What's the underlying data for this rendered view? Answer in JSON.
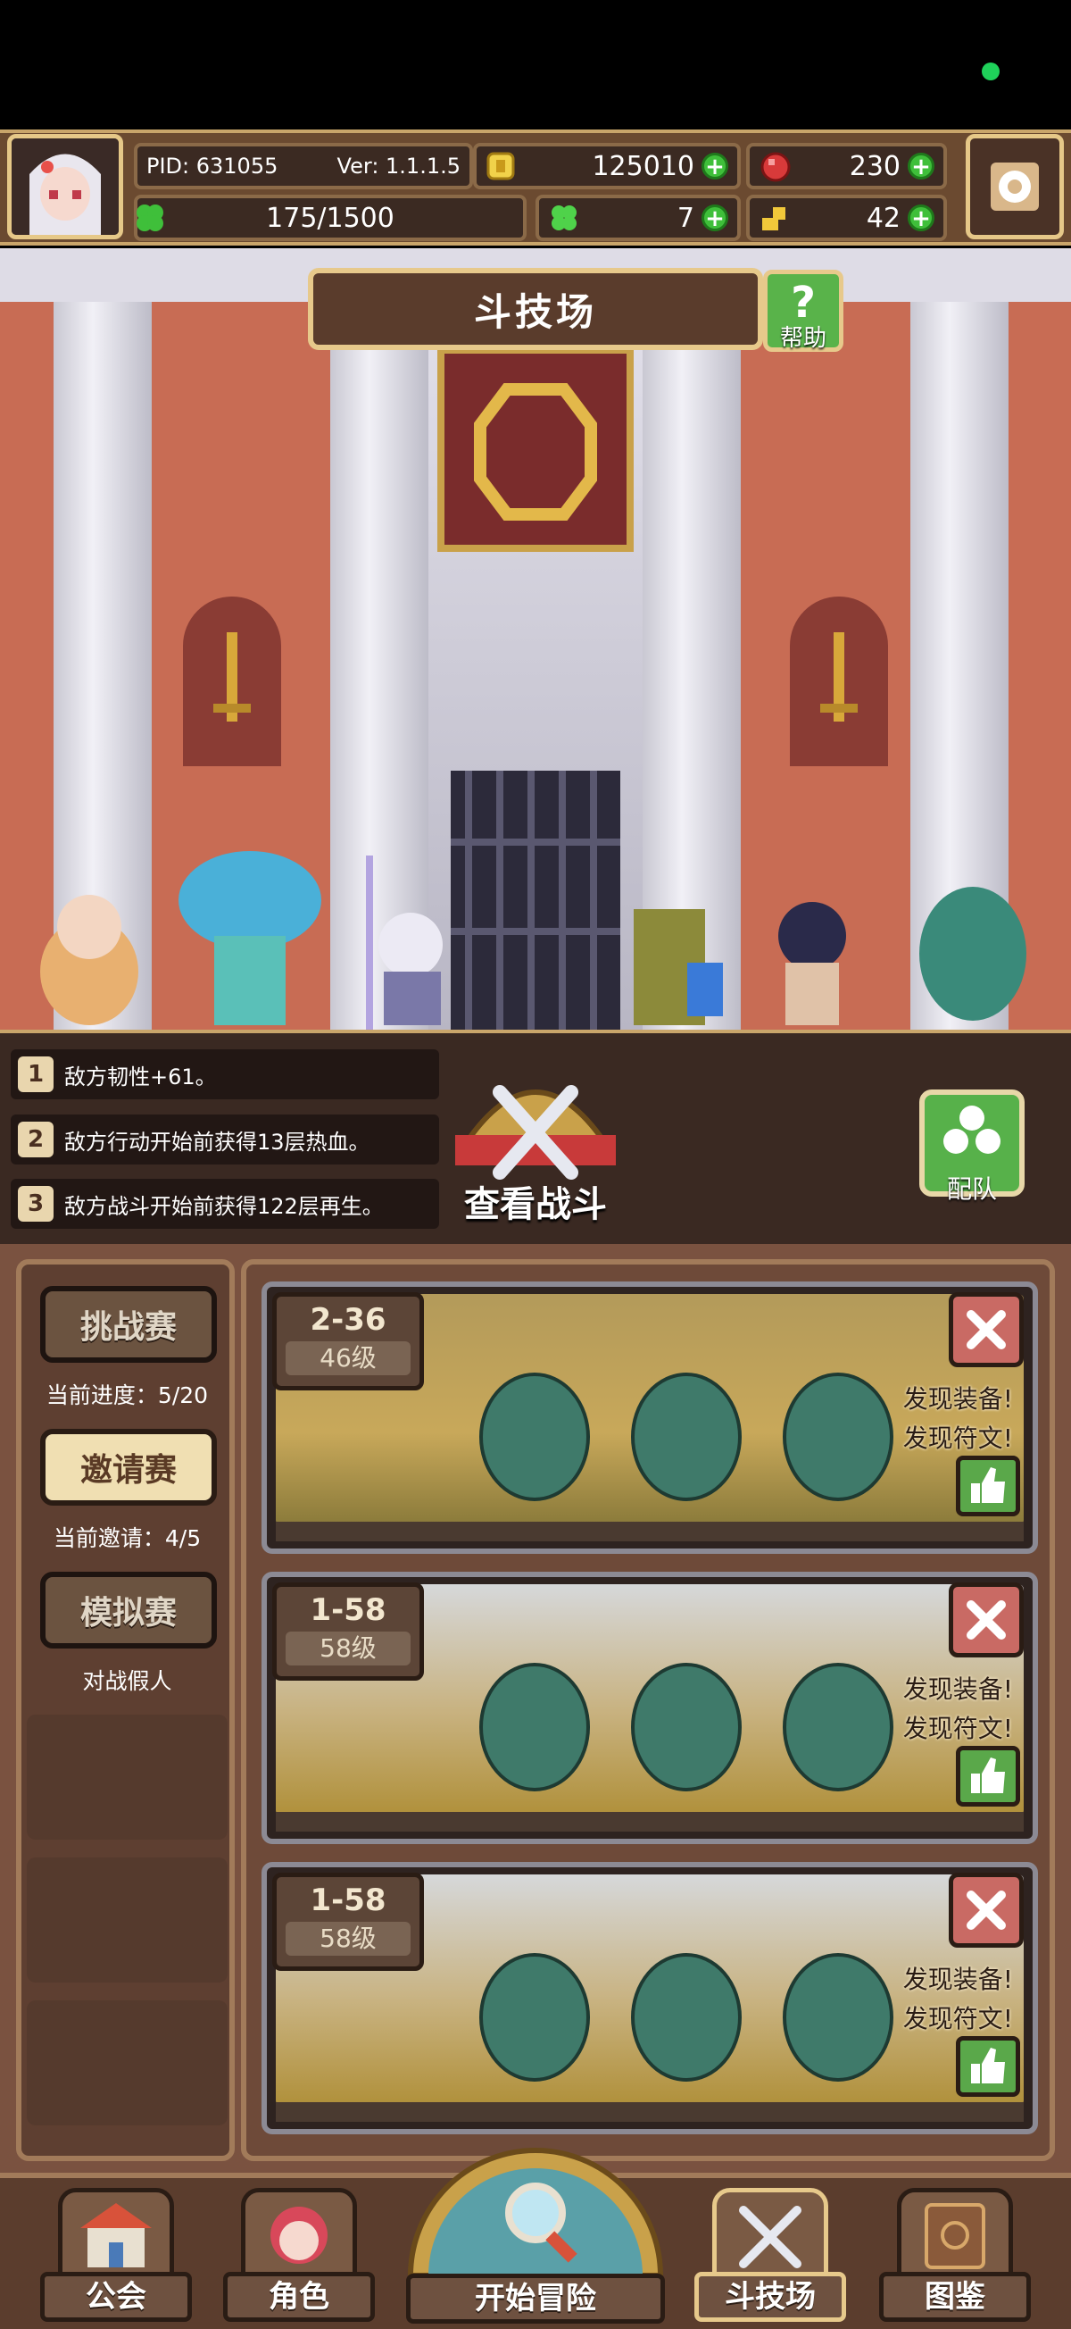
{
  "header": {
    "pid": "PID: 631055",
    "version": "Ver: 1.1.1.5",
    "gold": "125010",
    "gems": "230",
    "stamina": "175/1500",
    "clover": "7",
    "keys": "42"
  },
  "arena": {
    "title": "斗技场",
    "help_label": "帮助"
  },
  "buffs": [
    {
      "num": "1",
      "text": "敌方韧性+61。"
    },
    {
      "num": "2",
      "text": "敌方行动开始前获得13层热血。"
    },
    {
      "num": "3",
      "text": "敌方战斗开始前获得122层再生。"
    }
  ],
  "view_battle_label": "查看战斗",
  "team_label": "配队",
  "modes": [
    {
      "label": "挑战赛",
      "sub": "当前进度：5/20"
    },
    {
      "label": "邀请赛",
      "sub": "当前邀请：4/5"
    },
    {
      "label": "模拟赛",
      "sub": "对战假人"
    }
  ],
  "opponents": [
    {
      "stage": "2-36",
      "level": "46级",
      "find1": "发现装备!",
      "find2": "发现符文!"
    },
    {
      "stage": "1-58",
      "level": "58级",
      "find1": "发现装备!",
      "find2": "发现符文!"
    },
    {
      "stage": "1-58",
      "level": "58级",
      "find1": "发现装备!",
      "find2": "发现符文!"
    }
  ],
  "nav": {
    "guild": "公会",
    "character": "角色",
    "adventure": "开始冒险",
    "arena": "斗技场",
    "codex": "图鉴"
  },
  "colors": {
    "accent_gold": "#e7c98b",
    "panel_brown": "#5e3f31",
    "button_green": "#57b14a",
    "close_red": "#c96a64"
  },
  "icons": [
    "avatar",
    "settings-gear-icon",
    "gold-coin-icon",
    "ruby-gem-icon",
    "clover-icon",
    "key-icon",
    "help-icon",
    "crossed-swords-icon",
    "team-icon",
    "close-icon",
    "thumbs-up-icon"
  ]
}
